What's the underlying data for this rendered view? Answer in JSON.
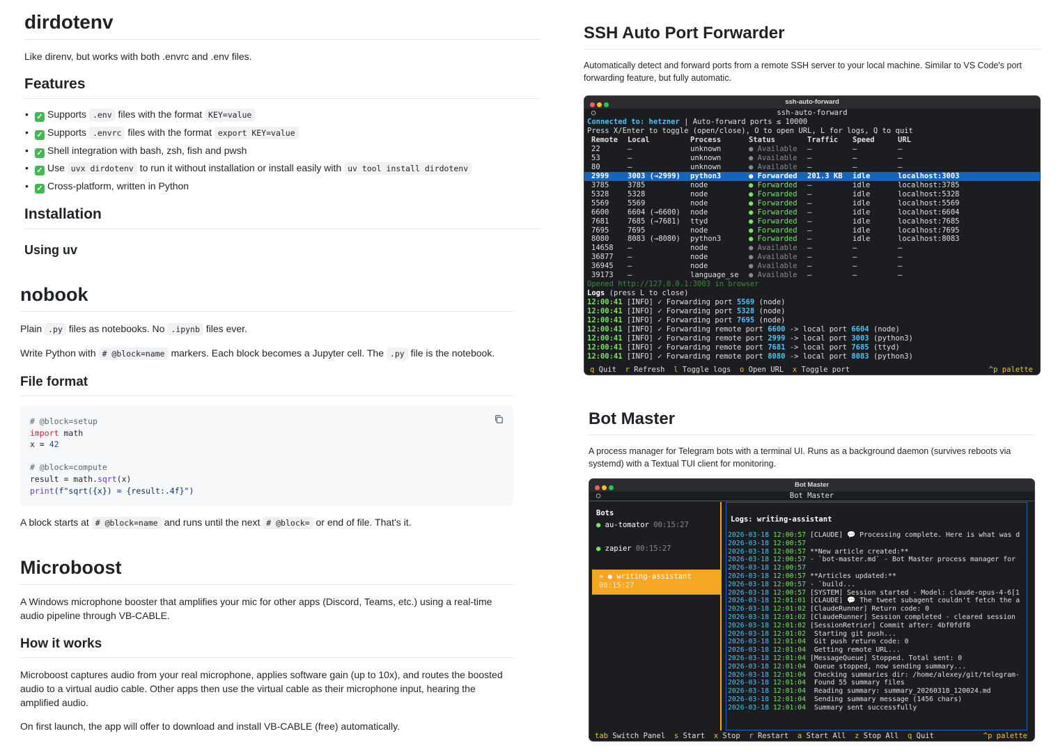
{
  "dirdotenv": {
    "title": "dirdotenv",
    "tagline": "Like direnv, but works with both .envrc and .env files.",
    "features_heading": "Features",
    "features": [
      {
        "t1": "Supports ",
        "c1": ".env",
        "t2": " files with the format ",
        "c2": "KEY=value",
        "t3": ""
      },
      {
        "t1": "Supports ",
        "c1": ".envrc",
        "t2": " files with the format ",
        "c2": "export KEY=value",
        "t3": ""
      },
      {
        "t1": "Shell integration with bash, zsh, fish and pwsh",
        "c1": "",
        "t2": "",
        "c2": "",
        "t3": ""
      },
      {
        "t1": "Use ",
        "c1": "uvx dirdotenv",
        "t2": " to run it without installation or install easily with ",
        "c2": "uv tool install dirdotenv",
        "t3": ""
      },
      {
        "t1": "Cross-platform, written in Python",
        "c1": "",
        "t2": "",
        "c2": "",
        "t3": ""
      }
    ],
    "installation_heading": "Installation",
    "using_uv": "Using uv"
  },
  "nobook": {
    "title": "nobook",
    "p1a": "Plain ",
    "p1c1": ".py",
    "p1b": " files as notebooks. No ",
    "p1c2": ".ipynb",
    "p1d": " files ever.",
    "p2a": "Write Python with ",
    "p2c1": "# @block=name",
    "p2b": " markers. Each block becomes a Jupyter cell. The ",
    "p2c2": ".py",
    "p2d": " file is the notebook.",
    "file_format": "File format",
    "code": {
      "l1": "# @block=setup",
      "l2kw": "import",
      "l2": " math",
      "l3a": "x = ",
      "l3n": "42",
      "l5": "# @block=compute",
      "l6a": "result = math.",
      "l6f": "sqrt",
      "l6b": "(x)",
      "l7f": "print",
      "l7s": "(f\"sqrt({x}) = {result:.4f}\")"
    },
    "p3a": "A block starts at ",
    "p3c1": "# @block=name",
    "p3b": " and runs until the next ",
    "p3c2": "# @block=",
    "p3d": " or end of file. That's it."
  },
  "microboost": {
    "title": "Microboost",
    "desc": "A Windows microphone booster that amplifies your mic for other apps (Discord, Teams, etc.) using a real-time audio pipeline through VB-CABLE.",
    "how_heading": "How it works",
    "how": "Microboost captures audio from your real microphone, applies software gain (up to 10x), and routes the boosted audio to a virtual audio cable. Other apps then use the virtual cable as their microphone input, hearing the amplified audio.",
    "first_launch": "On first launch, the app will offer to download and install VB-CABLE (free) automatically."
  },
  "ssh": {
    "title": "SSH Auto Port Forwarder",
    "desc": "Automatically detect and forward ports from a remote SSH server to your local machine. Similar to VS Code's port forwarding feature, but fully automatic.",
    "window_title": "ssh-auto-forward",
    "header_title": "ssh-auto-forward",
    "connected_label": "Connected to:",
    "host": "hetzner",
    "auto_forward": " | Auto-forward ports ≤ 10000",
    "help": "Press X/Enter to toggle (open/close), O to open URL, L for logs, Q to quit",
    "columns": [
      "Remote",
      "Local",
      "Process",
      "Status",
      "Traffic",
      "Speed",
      "URL"
    ],
    "rows": [
      {
        "remote": "22",
        "local": "–",
        "process": "unknown",
        "status": "Available",
        "traffic": "–",
        "speed": "–",
        "url": "–"
      },
      {
        "remote": "53",
        "local": "–",
        "process": "unknown",
        "status": "Available",
        "traffic": "–",
        "speed": "–",
        "url": "–"
      },
      {
        "remote": "80",
        "local": "–",
        "process": "unknown",
        "status": "Available",
        "traffic": "–",
        "speed": "–",
        "url": "–"
      },
      {
        "remote": "2999",
        "local": "3003 (→2999)",
        "process": "python3",
        "status": "Forwarded",
        "traffic": "201.3 KB",
        "speed": "idle",
        "url": "localhost:3003"
      },
      {
        "remote": "3785",
        "local": "3785",
        "process": "node",
        "status": "Forwarded",
        "traffic": "–",
        "speed": "idle",
        "url": "localhost:3785"
      },
      {
        "remote": "5328",
        "local": "5328",
        "process": "node",
        "status": "Forwarded",
        "traffic": "–",
        "speed": "idle",
        "url": "localhost:5328"
      },
      {
        "remote": "5569",
        "local": "5569",
        "process": "node",
        "status": "Forwarded",
        "traffic": "–",
        "speed": "idle",
        "url": "localhost:5569"
      },
      {
        "remote": "6600",
        "local": "6604 (→6600)",
        "process": "node",
        "status": "Forwarded",
        "traffic": "–",
        "speed": "idle",
        "url": "localhost:6604"
      },
      {
        "remote": "7681",
        "local": "7685 (→7681)",
        "process": "ttyd",
        "status": "Forwarded",
        "traffic": "–",
        "speed": "idle",
        "url": "localhost:7685"
      },
      {
        "remote": "7695",
        "local": "7695",
        "process": "node",
        "status": "Forwarded",
        "traffic": "–",
        "speed": "idle",
        "url": "localhost:7695"
      },
      {
        "remote": "8080",
        "local": "8083 (→8080)",
        "process": "python3",
        "status": "Forwarded",
        "traffic": "–",
        "speed": "idle",
        "url": "localhost:8083"
      },
      {
        "remote": "14658",
        "local": "–",
        "process": "node",
        "status": "Available",
        "traffic": "–",
        "speed": "–",
        "url": "–"
      },
      {
        "remote": "36877",
        "local": "–",
        "process": "node",
        "status": "Available",
        "traffic": "–",
        "speed": "–",
        "url": "–"
      },
      {
        "remote": "36945",
        "local": "–",
        "process": "node",
        "status": "Available",
        "traffic": "–",
        "speed": "–",
        "url": "–"
      },
      {
        "remote": "39173",
        "local": "–",
        "process": "language_se",
        "status": "Available",
        "traffic": "–",
        "speed": "–",
        "url": "–"
      }
    ],
    "selected_row_index": 3,
    "opened_msg": "Opened http://127.0.0.1:3003 in browser",
    "logs_title": "Logs",
    "logs_hint": " (press L to close)",
    "logs": [
      {
        "time": "12:00:41",
        "a": " [INFO] ✓ Forwarding port ",
        "p1": "5569",
        "b": " (node)",
        "p2": "",
        "c": ""
      },
      {
        "time": "12:00:41",
        "a": " [INFO] ✓ Forwarding port ",
        "p1": "5328",
        "b": " (node)",
        "p2": "",
        "c": ""
      },
      {
        "time": "12:00:41",
        "a": " [INFO] ✓ Forwarding port ",
        "p1": "7695",
        "b": " (node)",
        "p2": "",
        "c": ""
      },
      {
        "time": "12:00:41",
        "a": " [INFO] ✓ Forwarding remote port ",
        "p1": "6600",
        "b": " -> local port ",
        "p2": "6604",
        "c": " (node)"
      },
      {
        "time": "12:00:41",
        "a": " [INFO] ✓ Forwarding remote port ",
        "p1": "2999",
        "b": " -> local port ",
        "p2": "3003",
        "c": " (python3)"
      },
      {
        "time": "12:00:41",
        "a": " [INFO] ✓ Forwarding remote port ",
        "p1": "7681",
        "b": " -> local port ",
        "p2": "7685",
        "c": " (ttyd)"
      },
      {
        "time": "12:00:41",
        "a": " [INFO] ✓ Forwarding remote port ",
        "p1": "8080",
        "b": " -> local port ",
        "p2": "8083",
        "c": " (python3)"
      }
    ],
    "footer": [
      {
        "key": "q",
        "label": " Quit"
      },
      {
        "key": "r",
        "label": " Refresh"
      },
      {
        "key": "l",
        "label": " Toggle logs"
      },
      {
        "key": "o",
        "label": " Open URL"
      },
      {
        "key": "x",
        "label": " Toggle port"
      }
    ],
    "palette": "^p palette"
  },
  "bot": {
    "title": "Bot Master",
    "desc": "A process manager for Telegram bots with a terminal UI. Runs as a background daemon (survives reboots via systemd) with a Textual TUI client for monitoring.",
    "window_title": "Bot Master",
    "header_title": "Bot Master",
    "bots_heading": "Bots",
    "bots": [
      {
        "name": "au-tomator",
        "time": "00:15:27"
      },
      {
        "name": "zapier",
        "time": "00:15:27"
      },
      {
        "name": "writing-assistant",
        "time": "00:15:27"
      }
    ],
    "logs_heading": "Logs: writing-assistant",
    "logs": [
      {
        "date": "2026-03-18",
        "time": "12:00:57",
        "msg": " [CLAUDE] 💬 Processing complete. Here is what was d"
      },
      {
        "date": "2026-03-18",
        "time": "12:00:57",
        "msg": ""
      },
      {
        "date": "2026-03-18",
        "time": "12:00:57",
        "msg": " **New article created:**"
      },
      {
        "date": "2026-03-18",
        "time": "12:00:57",
        "msg": " - `bot-master.md` - Bot Master process manager for"
      },
      {
        "date": "2026-03-18",
        "time": "12:00:57",
        "msg": ""
      },
      {
        "date": "2026-03-18",
        "time": "12:00:57",
        "msg": " **Articles updated:**"
      },
      {
        "date": "2026-03-18",
        "time": "12:00:57",
        "msg": " - `build..."
      },
      {
        "date": "2026-03-18",
        "time": "12:00:57",
        "msg": " [SYSTEM] Session started - Model: claude-opus-4-6[1"
      },
      {
        "date": "2026-03-18",
        "time": "12:01:01",
        "msg": " [CLAUDE] 💬 The tweet subagent couldn't fetch the a"
      },
      {
        "date": "2026-03-18",
        "time": "12:01:02",
        "msg": " [ClaudeRunner] Return code: 0"
      },
      {
        "date": "2026-03-18",
        "time": "12:01:02",
        "msg": " [ClaudeRunner] Session completed - cleared session"
      },
      {
        "date": "2026-03-18",
        "time": "12:01:02",
        "msg": " [SessionRetrier] Commit after: 4bf0fdf8"
      },
      {
        "date": "2026-03-18",
        "time": "12:01:02",
        "msg": "  Starting git push..."
      },
      {
        "date": "2026-03-18",
        "time": "12:01:04",
        "msg": "  Git push return code: 0"
      },
      {
        "date": "2026-03-18",
        "time": "12:01:04",
        "msg": "  Getting remote URL..."
      },
      {
        "date": "2026-03-18",
        "time": "12:01:04",
        "msg": " [MessageQueue] Stopped. Total sent: 0"
      },
      {
        "date": "2026-03-18",
        "time": "12:01:04",
        "msg": "  Queue stopped, now sending summary..."
      },
      {
        "date": "2026-03-18",
        "time": "12:01:04",
        "msg": "  Checking summaries dir: /home/alexey/git/telegram-"
      },
      {
        "date": "2026-03-18",
        "time": "12:01:04",
        "msg": "  Found 55 summary files"
      },
      {
        "date": "2026-03-18",
        "time": "12:01:04",
        "msg": "  Reading summary: summary_20260318_120024.md"
      },
      {
        "date": "2026-03-18",
        "time": "12:01:04",
        "msg": "  Sending summary message (1456 chars)"
      },
      {
        "date": "2026-03-18",
        "time": "12:01:04",
        "msg": "  Summary sent successfully"
      }
    ],
    "footer": [
      {
        "key": "tab",
        "label": " Switch Panel"
      },
      {
        "key": "s",
        "label": " Start"
      },
      {
        "key": "x",
        "label": " Stop"
      },
      {
        "key": "r",
        "label": " Restart"
      },
      {
        "key": "a",
        "label": " Start All"
      },
      {
        "key": "z",
        "label": " Stop All"
      },
      {
        "key": "q",
        "label": " Quit"
      }
    ],
    "palette": "^p palette"
  },
  "colors": {
    "accent_blue": "#1565c0",
    "forwarded_green": "#7ee06a",
    "key_yellow": "#e8c34a",
    "selected_bot": "#f5a623"
  },
  "icons": {
    "check": "✅",
    "copy": "copy-icon"
  }
}
